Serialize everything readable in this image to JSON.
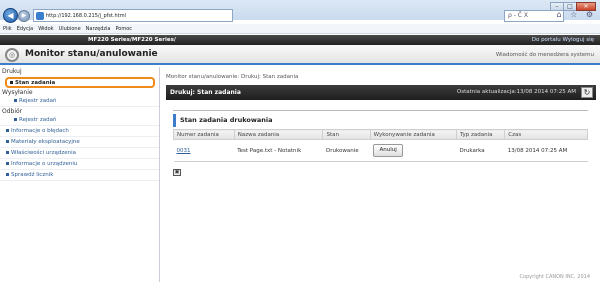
{
  "browser": {
    "url": "http://192.168.0.215/j_pfst.html",
    "addr_tools": "ρ - Ĉ X",
    "tool_icons": "⌂ ☆ ⚙",
    "menu": [
      "Plik",
      "Edycja",
      "Widok",
      "Ulubione",
      "Narzędzia",
      "Pomoc"
    ]
  },
  "header": {
    "product": "MF220 Series/MF220 Series/",
    "links": "Do portalu  Wyloguj się",
    "page_title": "Monitor stanu/anulowanie",
    "admin_link": "Wiadomość do menedżera systemu"
  },
  "sidebar": {
    "print_section": "Drukuj",
    "job_status": "Stan zadania",
    "send_section": "Wysyłanie",
    "send_log": "Rejestr zadań",
    "receive_section": "Odbiór",
    "receive_log": "Rejestr zadań",
    "items": [
      "Informacje o błędach",
      "Materiały eksploatacyjne",
      "Właściwości urządzenia",
      "Informacje o urządzeniu",
      "Sprawdź licznik"
    ]
  },
  "content": {
    "breadcrumb": "Monitor stanu/anulowanie: Drukuj: Stan zadania",
    "section_title": "Drukuj: Stan zadania",
    "last_update": "Ostatnia aktualizacja:13/08 2014 07:25 AM",
    "panel_title": "Stan zadania drukowania",
    "columns": [
      "Numer zadania",
      "Nazwa zadania",
      "Stan",
      "Wykonywanie zadania",
      "Typ zadania",
      "Czas"
    ],
    "row": {
      "number": "0031",
      "name": "Test Page.txt - Notatnik",
      "status": "Drukowanie",
      "action": "Anuluj",
      "type": "Drukarka",
      "time": "13/08 2014 07:25 AM"
    },
    "copyright": "Copyright CANON INC. 2014"
  }
}
